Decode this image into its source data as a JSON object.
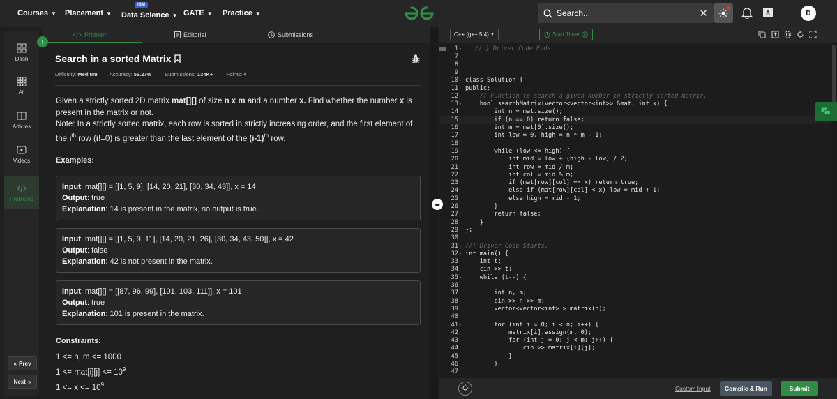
{
  "topnav": {
    "items": [
      "Courses",
      "Placement",
      "Data Science",
      "GATE",
      "Practice"
    ],
    "ibm_badge": "IBM",
    "search_placeholder": "Search...",
    "avatar_initial": "D",
    "lang_glyph": "A"
  },
  "sidebar": {
    "items": [
      "Dash",
      "All",
      "Articles",
      "Videos",
      "Problems"
    ],
    "active": "Problems",
    "prev_label": "Prev",
    "next_label": "Next"
  },
  "tabs": [
    "Problem",
    "Editorial",
    "Submissions"
  ],
  "problem": {
    "title": "Search in a sorted Matrix",
    "difficulty_label": "Difficulty:",
    "difficulty": "Medium",
    "accuracy_label": "Accuracy:",
    "accuracy": "56.27%",
    "submissions_label": "Submissions:",
    "submissions": "134K+",
    "points_label": "Points:",
    "points": "4",
    "statement": {
      "p1_a": "Given a strictly sorted 2D matrix ",
      "p1_b": "mat[][]",
      "p1_c": " of size ",
      "p1_d": "n x m",
      "p1_e": " and a number ",
      "p1_f": "x.",
      "p1_g": " Find whether the number ",
      "p1_h": "x",
      "p1_i": " is present in the matrix or not.",
      "p2_a": "Note: In a strictly sorted matrix, each row is sorted in strictly increasing order, and the first element of the ",
      "p2_b": "i",
      "p2_c": "th",
      "p2_d": " row (",
      "p2_e": "i",
      "p2_f": "!=0) is greater than the last element of the ",
      "p2_g": "(i-1)",
      "p2_h": "th",
      "p2_i": " row."
    },
    "examples_heading": "Examples:",
    "input_label": "Input",
    "output_label": "Output",
    "explanation_label": "Explanation",
    "examples": [
      {
        "input": "mat[][] = [[1, 5, 9], [14, 20, 21], [30, 34, 43]], x = 14",
        "output": "true",
        "explanation": "14 is present in the matrix, so output is true."
      },
      {
        "input": "mat[][] = [[1, 5, 9, 11], [14, 20, 21, 26], [30, 34, 43, 50]], x = 42",
        "output": "false",
        "explanation": "42 is not present in the matrix."
      },
      {
        "input": "mat[][] = [[87, 96, 99], [101, 103, 111]], x = 101",
        "output": "true",
        "explanation": "101 is present in the matrix."
      }
    ],
    "constraints_heading": "Constraints:",
    "constraints": [
      {
        "text": "1 <= n, m <= 1000",
        "sup": ""
      },
      {
        "text": "1 <= mat[i][j] <= 10",
        "sup": "9"
      },
      {
        "text": "1 <= x <= 10",
        "sup": "9"
      }
    ]
  },
  "editor": {
    "language": "C++ (g++ 5.4)",
    "timer_label": "Start Timer",
    "lines": [
      {
        "n": "1",
        "text": "// } Driver Code Ends"
      },
      {
        "n": "7",
        "text": ""
      },
      {
        "n": "8",
        "text": ""
      },
      {
        "n": "9",
        "text": ""
      },
      {
        "n": "10",
        "text": "class Solution {"
      },
      {
        "n": "11",
        "text": "public:"
      },
      {
        "n": "12",
        "text": "    // Function to search a given number in strictly sorted matrix."
      },
      {
        "n": "13",
        "text": "    bool searchMatrix(vector<vector<int>> &mat, int x) {"
      },
      {
        "n": "14",
        "text": "        int n = mat.size();"
      },
      {
        "n": "15",
        "text": "        if (n == 0) return false;"
      },
      {
        "n": "16",
        "text": "        int m = mat[0].size();"
      },
      {
        "n": "17",
        "text": "        int low = 0, high = n * m - 1;"
      },
      {
        "n": "18",
        "text": ""
      },
      {
        "n": "19",
        "text": "        while (low <= high) {"
      },
      {
        "n": "20",
        "text": "            int mid = low + (high - low) / 2;"
      },
      {
        "n": "21",
        "text": "            int row = mid / m;"
      },
      {
        "n": "22",
        "text": "            int col = mid % m;"
      },
      {
        "n": "23",
        "text": "            if (mat[row][col] == x) return true;"
      },
      {
        "n": "24",
        "text": "            else if (mat[row][col] < x) low = mid + 1;"
      },
      {
        "n": "25",
        "text": "            else high = mid - 1;"
      },
      {
        "n": "26",
        "text": "        }"
      },
      {
        "n": "27",
        "text": "        return false;"
      },
      {
        "n": "28",
        "text": "    }"
      },
      {
        "n": "29",
        "text": "};"
      },
      {
        "n": "30",
        "text": ""
      },
      {
        "n": "31",
        "text": "//{ Driver Code Starts."
      },
      {
        "n": "32",
        "text": "int main() {"
      },
      {
        "n": "33",
        "text": "    int t;"
      },
      {
        "n": "34",
        "text": "    cin >> t;"
      },
      {
        "n": "35",
        "text": "    while (t--) {"
      },
      {
        "n": "36",
        "text": ""
      },
      {
        "n": "37",
        "text": "        int n, m;"
      },
      {
        "n": "38",
        "text": "        cin >> n >> m;"
      },
      {
        "n": "39",
        "text": "        vector<vector<int> > matrix(n);"
      },
      {
        "n": "40",
        "text": ""
      },
      {
        "n": "41",
        "text": "        for (int i = 0; i < n; i++) {"
      },
      {
        "n": "42",
        "text": "            matrix[i].assign(m, 0);"
      },
      {
        "n": "43",
        "text": "            for (int j = 0; j < m; j++) {"
      },
      {
        "n": "44",
        "text": "                cin >> matrix[i][j];"
      },
      {
        "n": "45",
        "text": "            }"
      },
      {
        "n": "46",
        "text": "        }"
      },
      {
        "n": "47",
        "text": ""
      }
    ],
    "folds": [
      "1",
      "10",
      "13",
      "19",
      "31",
      "32",
      "35",
      "41",
      "43"
    ],
    "custom_input_label": "Custom Input",
    "compile_label": "Compile & Run",
    "submit_label": "Submit"
  },
  "colors": {
    "accent": "#2f8d46",
    "background": "#1f1f1f",
    "panel": "#262626"
  }
}
